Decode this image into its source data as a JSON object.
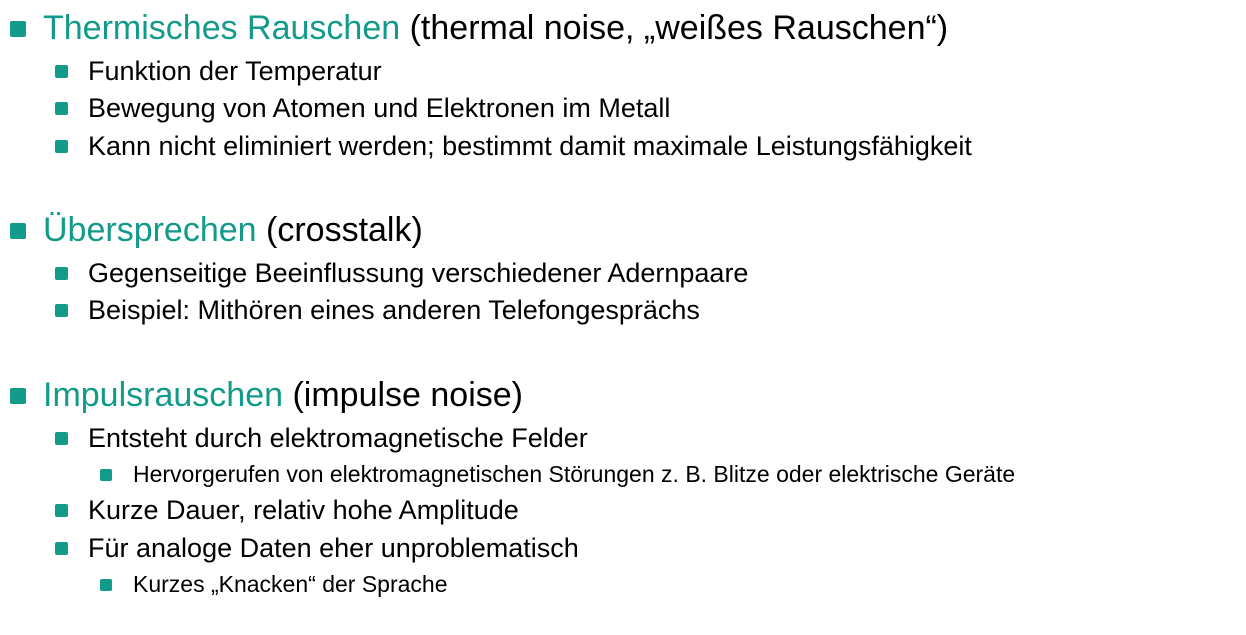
{
  "sections": [
    {
      "title": "Thermisches Rauschen",
      "subtitle": " (thermal noise, „weißes Rauschen“)",
      "items": [
        "Funktion der Temperatur",
        "Bewegung von Atomen und Elektronen im Metall",
        "Kann nicht eliminiert werden; bestimmt damit maximale Leistungsfähigkeit"
      ]
    },
    {
      "title": "Übersprechen",
      "subtitle": " (crosstalk)",
      "items": [
        "Gegenseitige Beeinflussung verschiedener Adernpaare",
        "Beispiel: Mithören eines anderen Telefongesprächs"
      ]
    },
    {
      "title": "Impulsrauschen",
      "subtitle": " (impulse noise)",
      "items": [
        "Entsteht durch elektromagnetische Felder",
        "Kurze Dauer, relativ hohe Amplitude",
        "Für analoge Daten eher unproblematisch"
      ],
      "subitems": [
        "Hervorgerufen von elektromagnetischen Störungen z. B. Blitze oder elektrische Geräte",
        "Kurzes „Knacken“ der Sprache"
      ]
    }
  ],
  "colors": {
    "accent": "#129a8a",
    "text": "#000000",
    "background": "#ffffff"
  }
}
